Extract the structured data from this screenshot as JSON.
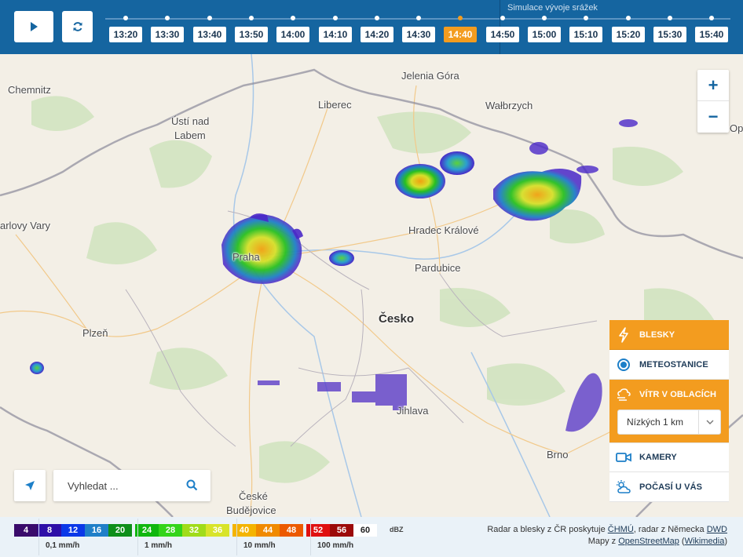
{
  "toolbar": {
    "play_label": "play",
    "refresh_label": "refresh",
    "simulation_label": "Simulace vývoje srážek",
    "times": [
      "13:20",
      "13:30",
      "13:40",
      "13:50",
      "14:00",
      "14:10",
      "14:20",
      "14:30",
      "14:40",
      "14:50",
      "15:00",
      "15:10",
      "15:20",
      "15:30",
      "15:40"
    ],
    "active_time": "14:40"
  },
  "map": {
    "cities": {
      "chemnitz": "Chemnitz",
      "usti_1": "Ústí nad",
      "usti_2": "Labem",
      "liberec": "Liberec",
      "jelenia": "Jelenia Góra",
      "walbrzych": "Wałbrzych",
      "karlovy": "arlovy Vary",
      "praha": "Praha",
      "hradec": "Hradec Králové",
      "pardubice": "Pardubice",
      "plzen": "Plzeň",
      "jihlava": "Jihlava",
      "brno": "Brno",
      "cb_1": "České",
      "cb_2": "Budějovice",
      "op": "Op"
    },
    "country": "Česko"
  },
  "zoom": {
    "in": "+",
    "out": "−"
  },
  "layers": {
    "blesky": "BLESKY",
    "meteostanice": "METEOSTANICE",
    "vitr": "VÍTR V OBLACÍCH",
    "vitr_select": "Nízkých 1 km",
    "kamery": "KAMERY",
    "pocasi": "POČASÍ U VÁS"
  },
  "search": {
    "placeholder": "Vyhledat ..."
  },
  "legend": {
    "scale": [
      {
        "v": "4",
        "bg": "#3a0b6b",
        "fg": "#fff"
      },
      {
        "v": "8",
        "bg": "#2e0fa8",
        "fg": "#fff"
      },
      {
        "v": "12",
        "bg": "#0b38e8",
        "fg": "#fff"
      },
      {
        "v": "16",
        "bg": "#1f7fc8",
        "fg": "#fff"
      },
      {
        "v": "20",
        "bg": "#0e8f1a",
        "fg": "#fff"
      },
      {
        "v": "24",
        "bg": "#10b70e",
        "fg": "#fff"
      },
      {
        "v": "28",
        "bg": "#33d41a",
        "fg": "#fff"
      },
      {
        "v": "32",
        "bg": "#a0dc1a",
        "fg": "#fff"
      },
      {
        "v": "36",
        "bg": "#d8e42a",
        "fg": "#fff"
      },
      {
        "v": "40",
        "bg": "#f4b400",
        "fg": "#fff"
      },
      {
        "v": "44",
        "bg": "#f08a00",
        "fg": "#fff"
      },
      {
        "v": "48",
        "bg": "#ec5a00",
        "fg": "#fff"
      },
      {
        "v": "52",
        "bg": "#e01010",
        "fg": "#fff"
      },
      {
        "v": "56",
        "bg": "#9c0a0a",
        "fg": "#fff"
      },
      {
        "v": "60",
        "bg": "#ffffff",
        "fg": "#222"
      }
    ],
    "unit": "dBZ",
    "mmh": [
      "0,1 mm/h",
      "1 mm/h",
      "10 mm/h",
      "100 mm/h"
    ],
    "credits_1a": "Radar a blesky z ČR poskytuje ",
    "credits_chmu": "ČHMÚ",
    "credits_1b": ", radar z Německa ",
    "credits_dwd": "DWD",
    "credits_2a": "Mapy z ",
    "credits_osm": "OpenStreetMap",
    "credits_2b": " (",
    "credits_wiki": "Wikimedia",
    "credits_2c": ")"
  }
}
